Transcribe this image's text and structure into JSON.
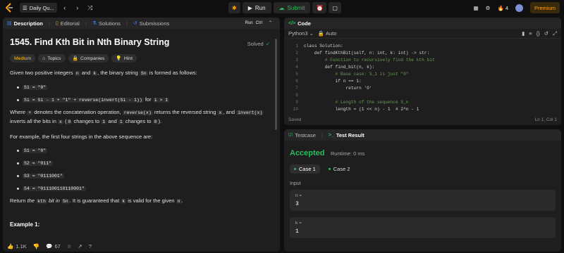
{
  "topbar": {
    "problem_list_label": "Daily Qu...",
    "run_label": "Run",
    "submit_label": "Submit",
    "streak_count": "4",
    "premium_label": "Premium"
  },
  "left_panel": {
    "tabs": [
      {
        "label": "Description"
      },
      {
        "label": "Editorial"
      },
      {
        "label": "Solutions"
      },
      {
        "label": "Submissions"
      }
    ],
    "run_shortcut": "Run",
    "ctrl_key": "Ctrl",
    "title": "1545. Find Kth Bit in Nth Binary String",
    "solved_label": "Solved",
    "pills": [
      "Medium",
      "Topics",
      "Companies",
      "Hint"
    ],
    "para1_a": "Given two positive integers",
    "para1_n": "n",
    "para1_b": "and",
    "para1_k": "k",
    "para1_c": ", the binary string",
    "para1_sn": "Sn",
    "para1_d": "is formed as follows:",
    "rule1": "S1 = \"0\"",
    "rule2a": "Si = Si - 1 + \"1\" + reverse(invert(Si - 1))",
    "rule2b": "for",
    "rule2c": "i > 1",
    "para2_a": "Where",
    "para2_plus": "+",
    "para2_b": "denotes the concatenation operation,",
    "para2_rev": "reverse(x)",
    "para2_c": "returns the reversed string",
    "para2_x": "x",
    "para2_d": ", and",
    "para2_inv": "invert(x)",
    "para2_e": "inverts all the bits in",
    "para2_x2": "x",
    "para2_f": "(",
    "para2_0": "0",
    "para2_g": "changes to",
    "para2_1": "1",
    "para2_h": "and",
    "para2_1b": "1",
    "para2_i": "changes to",
    "para2_0b": "0",
    "para2_j": ").",
    "para3": "For example, the first four strings in the above sequence are:",
    "examples": [
      "S1 = \"0\"",
      "S2 = \"011\"",
      "S3 = \"0111001\"",
      "S4 = \"011100110110001\""
    ],
    "para4_a": "Return",
    "para4_the": "the",
    "para4_kth": "kth",
    "para4_bit": "bit",
    "para4_in": "in",
    "para4_sn": "Sn",
    "para4_b": ". It is guaranteed that",
    "para4_k": "k",
    "para4_c": "is valid for the given",
    "para4_n": "n",
    "para4_d": ".",
    "example1": "Example 1:",
    "likes": "1.1K",
    "comments": "67"
  },
  "code_panel": {
    "title": "Code",
    "language": "Python3",
    "auto_label": "Auto",
    "lines": [
      "class Solution:",
      "    def findKthBit(self, n: int, k: int) -> str:",
      "        # Function to recursively find the kth bit",
      "        def find_bit(n, k):",
      "            # Base case: S_1 is just \"0\"",
      "            if n == 1:",
      "                return '0'",
      "",
      "            # Length of the sequence S_n",
      "            length = (1 << n) - 1  # 2^n - 1"
    ],
    "status": "Saved",
    "cursor": "Ln 1, Col 1"
  },
  "result_panel": {
    "tabs": [
      {
        "label": "Testcase"
      },
      {
        "label": "Test Result"
      }
    ],
    "verdict": "Accepted",
    "runtime": "Runtime: 0 ms",
    "cases": [
      {
        "label": "Case 1"
      },
      {
        "label": "Case 2"
      }
    ],
    "input_label": "Input",
    "inputs": [
      {
        "name": "n =",
        "value": "3"
      },
      {
        "name": "k =",
        "value": "1"
      }
    ]
  },
  "colors": {
    "accent": "#ffa116",
    "success": "#2cbb5d",
    "medium": "#ffc01e",
    "panel": "#1e1e1e",
    "background": "#0f0f0f"
  }
}
